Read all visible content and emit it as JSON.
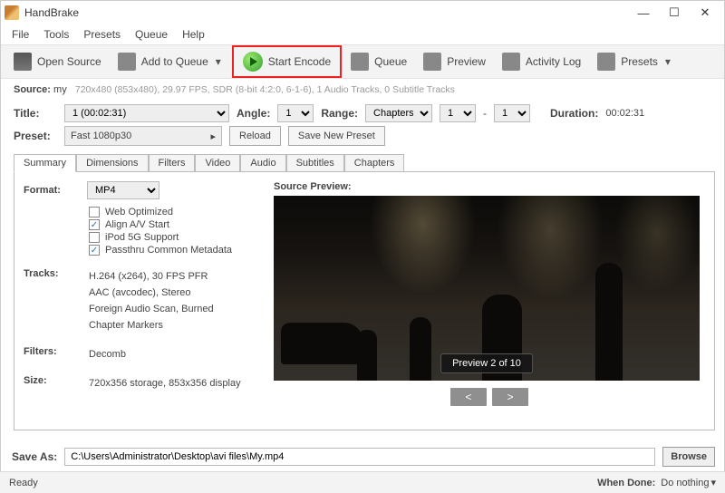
{
  "window": {
    "title": "HandBrake"
  },
  "menus": {
    "file": "File",
    "tools": "Tools",
    "presets": "Presets",
    "queue": "Queue",
    "help": "Help"
  },
  "toolbar": {
    "open_source": "Open Source",
    "add_to_queue": "Add to Queue",
    "start_encode": "Start Encode",
    "queue": "Queue",
    "preview": "Preview",
    "activity_log": "Activity Log",
    "presets": "Presets"
  },
  "source": {
    "label": "Source:",
    "name": "my",
    "details": "720x480 (853x480), 29.97 FPS, SDR (8-bit 4:2:0, 6-1-6), 1 Audio Tracks, 0 Subtitle Tracks"
  },
  "title_row": {
    "title_lbl": "Title:",
    "title_val": "1 (00:02:31)",
    "angle_lbl": "Angle:",
    "angle_val": "1",
    "range_lbl": "Range:",
    "range_type": "Chapters",
    "range_from": "1",
    "range_to": "1",
    "duration_lbl": "Duration:",
    "duration_val": "00:02:31"
  },
  "preset_row": {
    "lbl": "Preset:",
    "value": "Fast 1080p30",
    "reload": "Reload",
    "save_new": "Save New Preset"
  },
  "tabs": {
    "summary": "Summary",
    "dimensions": "Dimensions",
    "filters": "Filters",
    "video": "Video",
    "audio": "Audio",
    "subtitles": "Subtitles",
    "chapters": "Chapters"
  },
  "summary": {
    "format_lbl": "Format:",
    "format_val": "MP4",
    "web_opt": "Web Optimized",
    "align": "Align A/V Start",
    "ipod": "iPod 5G Support",
    "passthru": "Passthru Common Metadata",
    "tracks_lbl": "Tracks:",
    "tracks1": "H.264 (x264), 30 FPS PFR",
    "tracks2": "AAC (avcodec), Stereo",
    "tracks3": "Foreign Audio Scan, Burned",
    "tracks4": "Chapter Markers",
    "filters_lbl": "Filters:",
    "filters_val": "Decomb",
    "size_lbl": "Size:",
    "size_val": "720x356 storage, 853x356 display",
    "src_preview_lbl": "Source Preview:",
    "preview_badge": "Preview 2 of 10",
    "prev": "<",
    "next": ">"
  },
  "saveas": {
    "lbl": "Save As:",
    "path": "C:\\Users\\Administrator\\Desktop\\avi files\\My.mp4",
    "browse": "Browse"
  },
  "status": {
    "ready": "Ready",
    "when_done_lbl": "When Done:",
    "when_done_val": "Do nothing"
  }
}
